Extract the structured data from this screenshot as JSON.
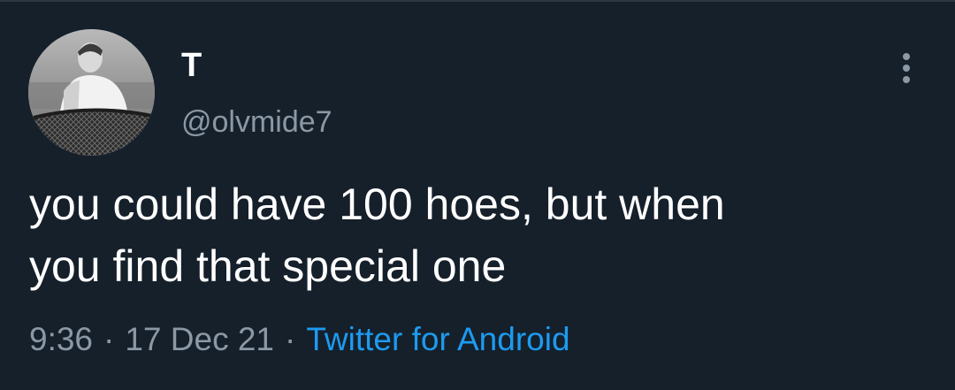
{
  "tweet": {
    "author": {
      "display_name": "T",
      "handle": "@olvmide7",
      "avatar_icon": "profile-photo"
    },
    "text": "you could have 100 hoes, but when\nyou find that special one",
    "time": "9:36",
    "date": "17 Dec 21",
    "separator": "·",
    "source": "Twitter for Android",
    "more_icon": "more-vertical-icon"
  },
  "colors": {
    "background": "#15202b",
    "text": "#ffffff",
    "secondary_text": "#8b98a5",
    "link": "#1d9bf0"
  }
}
